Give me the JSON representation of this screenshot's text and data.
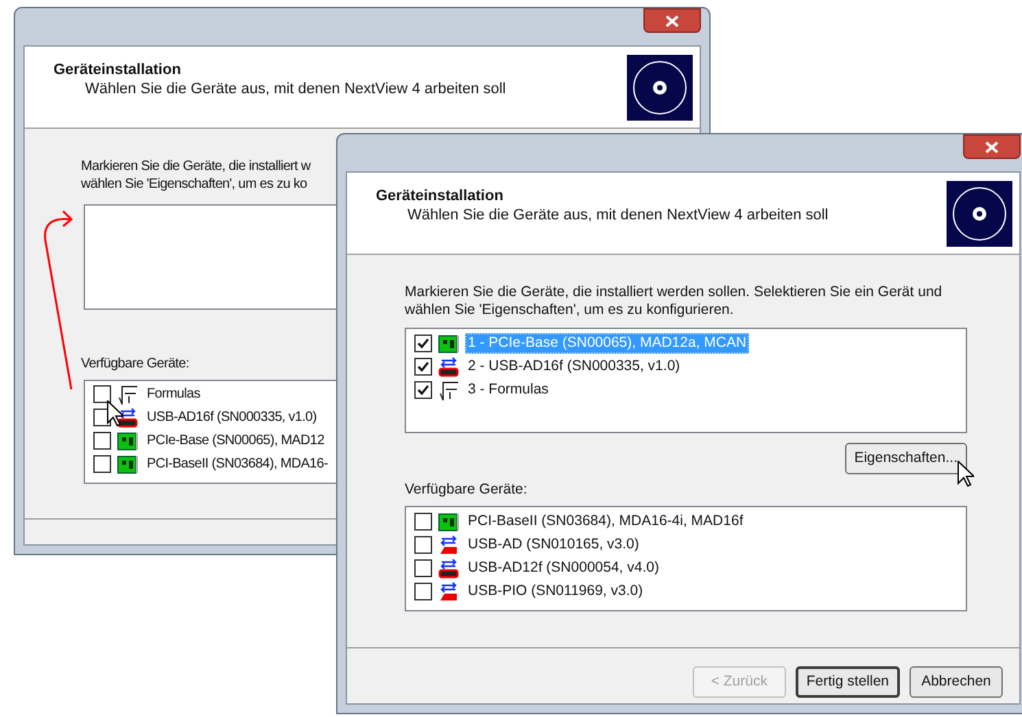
{
  "back_window": {
    "header": {
      "title": "Geräteinstallation",
      "subtitle": "Wählen Sie die Geräte aus, mit denen NextView 4 arbeiten soll"
    },
    "instructions": [
      "Markieren Sie die Geräte, die installiert w",
      "wählen Sie 'Eigenschaften', um es zu ko"
    ],
    "available_label": "Verfügbare Geräte:",
    "available_devices": [
      {
        "label": "Formulas",
        "checked": false,
        "kind": "formula"
      },
      {
        "label": "USB-AD16f (SN000335, v1.0)",
        "checked": false,
        "kind": "usb-box"
      },
      {
        "label": "PCIe-Base (SN00065), MAD12",
        "checked": false,
        "kind": "card"
      },
      {
        "label": "PCI-BaseII (SN03684), MDA16-",
        "checked": false,
        "kind": "card"
      }
    ]
  },
  "front_window": {
    "header": {
      "title": "Geräteinstallation",
      "subtitle": "Wählen Sie die Geräte aus, mit denen NextView 4 arbeiten soll"
    },
    "instructions": "Markieren Sie die Geräte, die installiert werden sollen. Selektieren Sie ein Gerät und wählen Sie 'Eigenschaften', um es zu konfigurieren.",
    "installed_devices": [
      {
        "label": "1 - PCIe-Base (SN00065), MAD12a, MCAN",
        "checked": true,
        "selected": true,
        "kind": "card"
      },
      {
        "label": "2 - USB-AD16f (SN000335, v1.0)",
        "checked": true,
        "selected": false,
        "kind": "usb-box"
      },
      {
        "label": "3 - Formulas",
        "checked": true,
        "selected": false,
        "kind": "formula"
      }
    ],
    "properties_button": "Eigenschaften...",
    "available_label": "Verfügbare Geräte:",
    "available_devices": [
      {
        "label": "PCI-BaseII (SN03684), MDA16-4i, MAD16f",
        "checked": false,
        "kind": "card"
      },
      {
        "label": "USB-AD (SN010165, v3.0)",
        "checked": false,
        "kind": "usb"
      },
      {
        "label": "USB-AD12f (SN000054, v4.0)",
        "checked": false,
        "kind": "usb-box"
      },
      {
        "label": "USB-PIO (SN011969, v3.0)",
        "checked": false,
        "kind": "usb"
      }
    ],
    "buttons": [
      {
        "label": "< Zurück",
        "disabled": true,
        "default": false
      },
      {
        "label": "Fertig stellen",
        "disabled": false,
        "default": true
      },
      {
        "label": "Abbrechen",
        "disabled": false,
        "default": false
      }
    ]
  }
}
